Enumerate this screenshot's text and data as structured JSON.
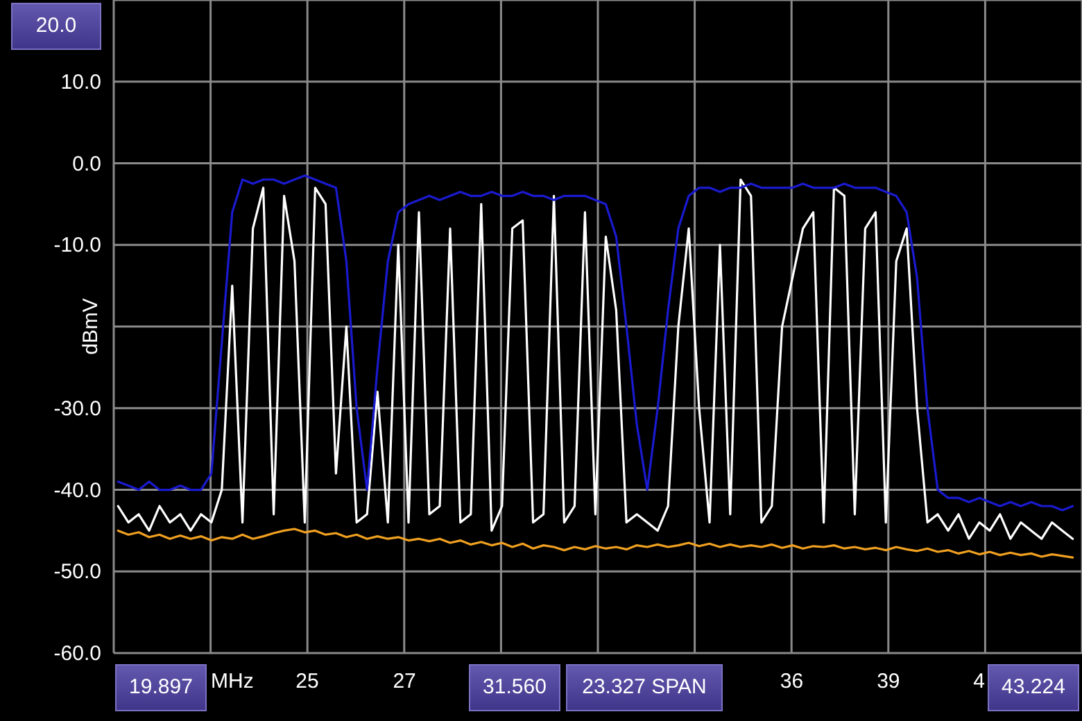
{
  "spectrum": {
    "reference_level": "20.0",
    "start_frequency": "19.897",
    "center_frequency": "31.560",
    "span": "23.327 SPAN",
    "stop_frequency": "43.224",
    "partial_tick_label": "4",
    "chart_data": {
      "type": "line",
      "grid": true,
      "xlabel": "MHz",
      "ylabel": "dBmV",
      "xlim": [
        19.897,
        43.224
      ],
      "ylim": [
        -60,
        20
      ],
      "xticks": [
        {
          "value": 24.56,
          "label": "25"
        },
        {
          "value": 26.9,
          "label": "27"
        },
        {
          "value": 36.23,
          "label": "36"
        },
        {
          "value": 38.56,
          "label": "39"
        }
      ],
      "yticks": [
        {
          "value": 10,
          "label": "10.0"
        },
        {
          "value": 0,
          "label": "0.0"
        },
        {
          "value": -10,
          "label": "-10.0"
        },
        {
          "value": -30,
          "label": "-30.0"
        },
        {
          "value": -40,
          "label": "-40.0"
        },
        {
          "value": -50,
          "label": "-50.0"
        },
        {
          "value": -60,
          "label": "-60.0"
        }
      ],
      "x": [
        20,
        20.25,
        20.5,
        20.75,
        21,
        21.25,
        21.5,
        21.75,
        22,
        22.25,
        22.5,
        22.75,
        23,
        23.25,
        23.5,
        23.75,
        24,
        24.25,
        24.5,
        24.75,
        25,
        25.25,
        25.5,
        25.75,
        26,
        26.25,
        26.5,
        26.75,
        27,
        27.25,
        27.5,
        27.75,
        28,
        28.25,
        28.5,
        28.75,
        29,
        29.25,
        29.5,
        29.75,
        30,
        30.25,
        30.5,
        30.75,
        31,
        31.25,
        31.5,
        31.75,
        32,
        32.25,
        32.5,
        32.75,
        33,
        33.25,
        33.5,
        33.75,
        34,
        34.25,
        34.5,
        34.75,
        35,
        35.25,
        35.5,
        35.75,
        36,
        36.25,
        36.5,
        36.75,
        37,
        37.25,
        37.5,
        37.75,
        38,
        38.25,
        38.5,
        38.75,
        39,
        39.25,
        39.5,
        39.75,
        40,
        40.25,
        40.5,
        40.75,
        41,
        41.25,
        41.5,
        41.75,
        42,
        42.25,
        42.5,
        42.75,
        43
      ],
      "series": [
        {
          "color": "#f0a020",
          "values": [
            -45,
            -45.5,
            -45.2,
            -45.8,
            -45.5,
            -46,
            -45.6,
            -46,
            -45.7,
            -46.2,
            -45.8,
            -46,
            -45.5,
            -46,
            -45.7,
            -45.3,
            -45,
            -44.8,
            -45.2,
            -45,
            -45.5,
            -45.3,
            -45.8,
            -45.5,
            -46,
            -45.7,
            -46,
            -45.8,
            -46.2,
            -46,
            -46.3,
            -46,
            -46.5,
            -46.2,
            -46.7,
            -46.4,
            -46.8,
            -46.5,
            -47,
            -46.6,
            -47.2,
            -46.8,
            -47,
            -47.4,
            -47,
            -47.3,
            -46.9,
            -47.2,
            -47,
            -47.3,
            -46.8,
            -47,
            -46.7,
            -47,
            -46.8,
            -46.5,
            -46.9,
            -46.6,
            -47,
            -46.7,
            -47,
            -46.8,
            -47,
            -46.7,
            -47.1,
            -46.8,
            -47.2,
            -46.9,
            -47,
            -46.8,
            -47.2,
            -47,
            -47.3,
            -47.1,
            -47.4,
            -47,
            -47.3,
            -47.5,
            -47.2,
            -47.6,
            -47.4,
            -47.8,
            -47.5,
            -47.9,
            -47.6,
            -48,
            -47.7,
            -48,
            -47.8,
            -48.2,
            -47.9,
            -48.1,
            -48.3
          ]
        },
        {
          "color": "#ffffff",
          "values": [
            -42,
            -44,
            -43,
            -45,
            -42,
            -44,
            -43,
            -45,
            -43,
            -44,
            -40,
            -15,
            -44,
            -8,
            -3,
            -43,
            -4,
            -12,
            -44,
            -3,
            -5,
            -38,
            -20,
            -44,
            -43,
            -28,
            -44,
            -10,
            -44,
            -6,
            -43,
            -42,
            -8,
            -44,
            -43,
            -5,
            -45,
            -42,
            -8,
            -7,
            -44,
            -43,
            -4,
            -44,
            -42,
            -6,
            -43,
            -9,
            -18,
            -44,
            -43,
            -44,
            -45,
            -42,
            -20,
            -8,
            -30,
            -44,
            -10,
            -43,
            -2,
            -4,
            -44,
            -42,
            -20,
            -14,
            -8,
            -6,
            -44,
            -3,
            -4,
            -43,
            -8,
            -6,
            -44,
            -12,
            -8,
            -30,
            -44,
            -43,
            -45,
            -43,
            -46,
            -44,
            -45,
            -43,
            -46,
            -44,
            -45,
            -46,
            -44,
            -45,
            -46
          ]
        },
        {
          "color": "#1a1ad0",
          "values": [
            -39,
            -39.5,
            -40,
            -39,
            -40,
            -40,
            -39.5,
            -40,
            -40,
            -38,
            -22,
            -6,
            -2,
            -2.5,
            -2,
            -2,
            -2.5,
            -2,
            -1.5,
            -2,
            -2.5,
            -3,
            -12,
            -30,
            -40,
            -25,
            -12,
            -6,
            -5,
            -4.5,
            -4,
            -4.5,
            -4,
            -3.5,
            -4,
            -4,
            -3.5,
            -4,
            -4,
            -3.5,
            -4,
            -4,
            -4.5,
            -4,
            -4,
            -4,
            -4.5,
            -5,
            -9,
            -20,
            -32,
            -40,
            -30,
            -18,
            -8,
            -4,
            -3,
            -3,
            -3.5,
            -3,
            -3,
            -2.5,
            -3,
            -3,
            -3,
            -3,
            -2.5,
            -3,
            -3,
            -3,
            -2.5,
            -3,
            -3,
            -3,
            -3.5,
            -4,
            -6,
            -14,
            -30,
            -40,
            -41,
            -41,
            -41.5,
            -41,
            -41.5,
            -42,
            -41.5,
            -42,
            -41.5,
            -42,
            -42,
            -42.5,
            -42
          ]
        }
      ]
    }
  }
}
